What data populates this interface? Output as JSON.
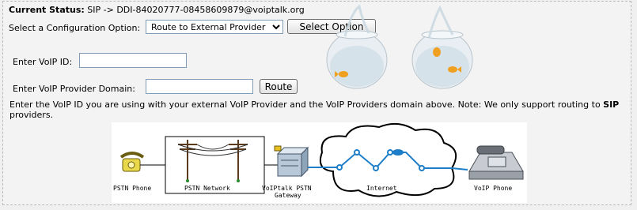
{
  "status": {
    "label": "Current Status:",
    "value": "SIP -> DDI-84020777-08458609879@voiptalk.org"
  },
  "config": {
    "label": "Select a Configuration Option:",
    "selected": "Route to External Provider",
    "button": "Select Option"
  },
  "voip_id": {
    "label": "Enter VoIP ID:",
    "value": ""
  },
  "domain": {
    "label": "Enter VoIP Provider Domain:",
    "value": "",
    "button": "Route"
  },
  "note": {
    "prefix": "Enter the VoIP ID you are using with your external VoIP Provider and the VoIP Providers domain above. Note: We only support routing to ",
    "bold": "SIP",
    "suffix": " providers."
  },
  "diagram": {
    "pstn_phone": "PSTN Phone",
    "pstn_network": "PSTN Network",
    "gateway_line1": "VoIPtalk PSTN",
    "gateway_line2": "Gateway",
    "internet": "Internet",
    "voip_phone": "VoIP Phone"
  },
  "colors": {
    "network_line": "#1e7fc8",
    "node": "#1e7fc8",
    "phone": "#e8d84a"
  }
}
